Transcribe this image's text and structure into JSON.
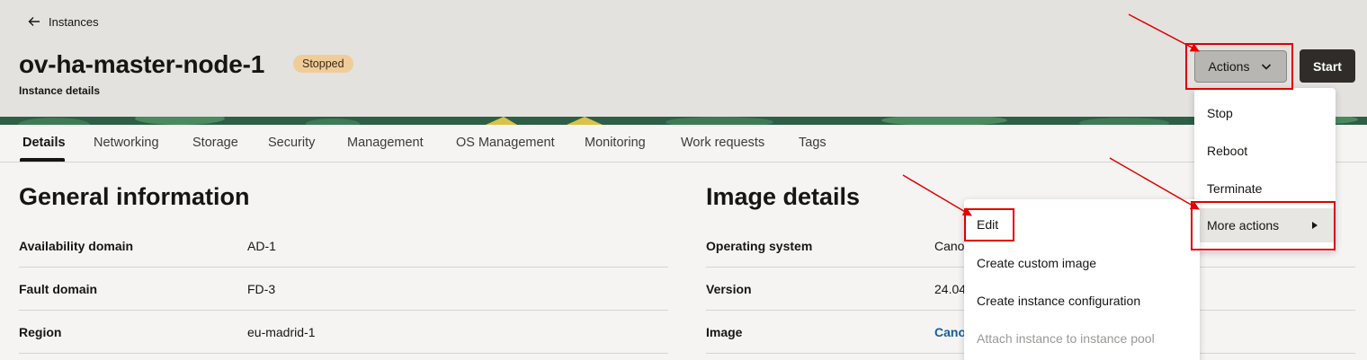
{
  "header": {
    "back_label": "Instances",
    "title": "ov-ha-master-node-1",
    "status": "Stopped",
    "subtitle": "Instance details",
    "actions_label": "Actions",
    "start_label": "Start"
  },
  "tabs": [
    {
      "label": "Details"
    },
    {
      "label": "Networking"
    },
    {
      "label": "Storage"
    },
    {
      "label": "Security"
    },
    {
      "label": "Management"
    },
    {
      "label": "OS Management"
    },
    {
      "label": "Monitoring"
    },
    {
      "label": "Work requests"
    },
    {
      "label": "Tags"
    }
  ],
  "general": {
    "title": "General information",
    "rows": [
      {
        "label": "Availability domain",
        "value": "AD-1"
      },
      {
        "label": "Fault domain",
        "value": "FD-3"
      },
      {
        "label": "Region",
        "value": "eu-madrid-1"
      }
    ]
  },
  "image": {
    "title": "Image details",
    "rows": [
      {
        "label": "Operating system",
        "value": "Cano"
      },
      {
        "label": "Version",
        "value": "24.04"
      },
      {
        "label": "Image",
        "value": "Cano"
      }
    ]
  },
  "actions_menu": {
    "items": [
      {
        "label": "Stop"
      },
      {
        "label": "Reboot"
      },
      {
        "label": "Terminate"
      },
      {
        "label": "More actions"
      }
    ]
  },
  "more_menu": {
    "items": [
      {
        "label": "Edit"
      },
      {
        "label": "Create custom image"
      },
      {
        "label": "Create instance configuration"
      },
      {
        "label": "Attach instance to instance pool"
      }
    ]
  },
  "colors": {
    "annotation": "#e00000",
    "badge": "#f0cc99",
    "link": "#1a5c99"
  }
}
